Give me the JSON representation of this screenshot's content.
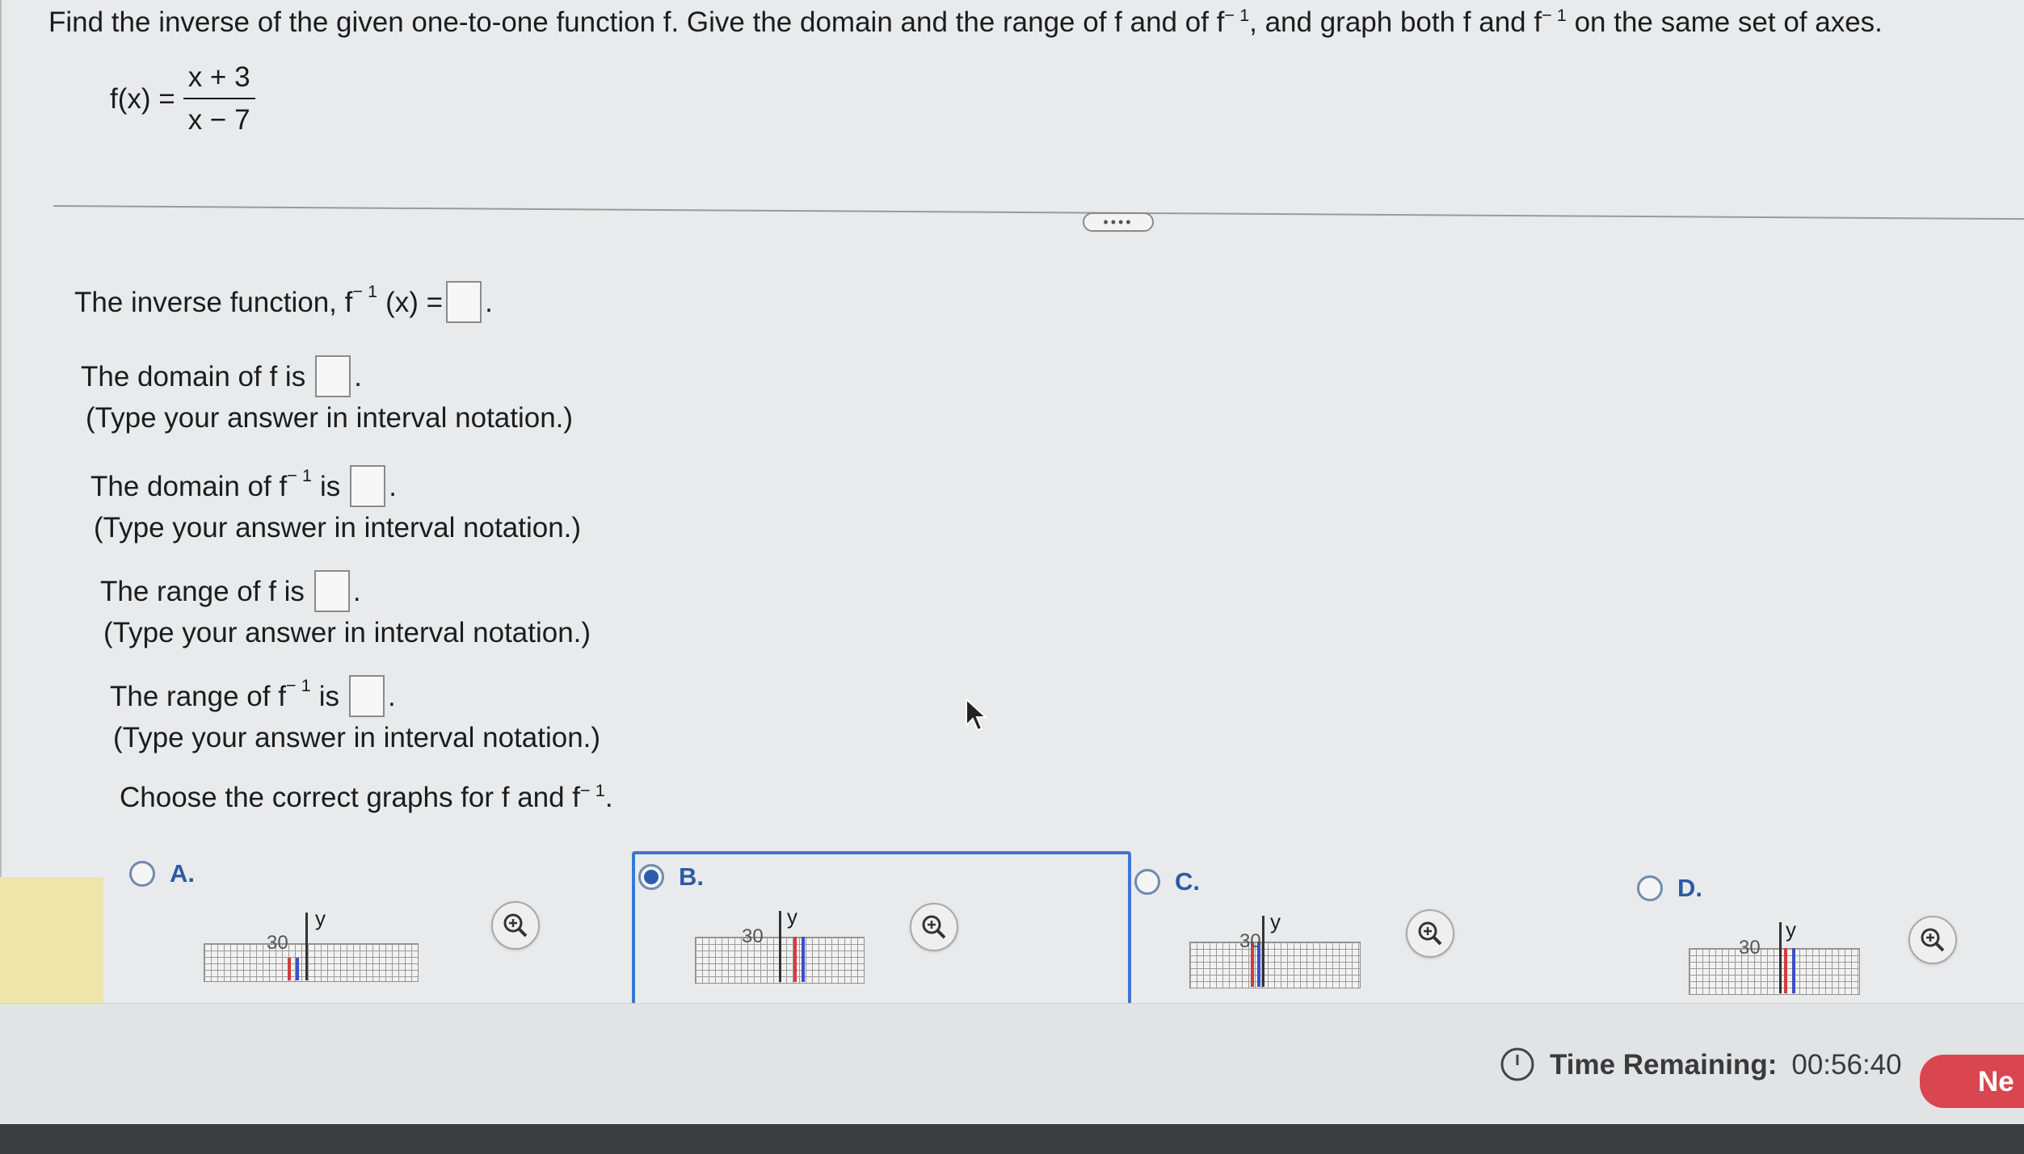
{
  "question": {
    "prompt_part1": "Find the inverse of the given one-to-one function f. Give the domain and the range of f and of f",
    "prompt_sup1": "− 1",
    "prompt_part2": ", and graph both f and f",
    "prompt_sup2": "− 1",
    "prompt_part3": " on the same set of axes.",
    "function_lhs": "f(x) =",
    "function_numerator": "x + 3",
    "function_denominator": "x − 7"
  },
  "divider": {
    "more_label": "••••"
  },
  "answers": {
    "inverse": {
      "prefix": "The inverse function, f",
      "sup": "− 1",
      "suffix": "(x) =",
      "end": "."
    },
    "domain_f": {
      "prefix": "The domain of f is",
      "end": ".",
      "hint": "(Type your answer in interval notation.)"
    },
    "domain_finv": {
      "prefix": "The domain of f",
      "sup": "− 1",
      "mid": " is",
      "end": ".",
      "hint": "(Type your answer in interval notation.)"
    },
    "range_f": {
      "prefix": "The range of f is",
      "end": ".",
      "hint": "(Type your answer in interval notation.)"
    },
    "range_finv": {
      "prefix": "The range of f",
      "sup": "− 1",
      "mid": " is",
      "end": ".",
      "hint": "(Type your answer in interval notation.)"
    },
    "choose": {
      "text": "Choose the correct graphs for f and f",
      "sup": "− 1",
      "end": "."
    }
  },
  "options": [
    {
      "label": "A.",
      "selected": false,
      "y_axis_label": "y",
      "tick_label": "30"
    },
    {
      "label": "B.",
      "selected": true,
      "y_axis_label": "y",
      "tick_label": "30"
    },
    {
      "label": "C.",
      "selected": false,
      "y_axis_label": "y",
      "tick_label": "30"
    },
    {
      "label": "D.",
      "selected": false,
      "y_axis_label": "y",
      "tick_label": "30"
    }
  ],
  "footer": {
    "timer_label": "Time Remaining:",
    "timer_value": "00:56:40",
    "next_label": "Ne"
  },
  "colors": {
    "accent": "#2d5aa3",
    "next": "#d9464f",
    "graph_red": "#d23b3b",
    "graph_blue": "#3a4fc8"
  }
}
